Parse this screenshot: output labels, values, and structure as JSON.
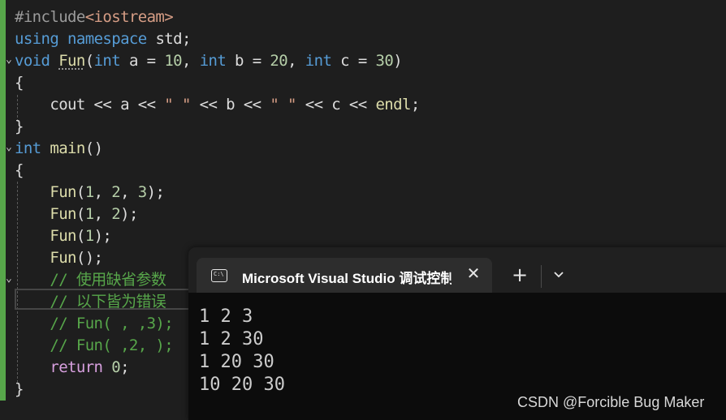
{
  "editor": {
    "lines": [
      {
        "segments": [
          {
            "t": "#include",
            "c": "pp"
          },
          {
            "t": "<iostream>",
            "c": "str"
          }
        ]
      },
      {
        "segments": [
          {
            "t": "using",
            "c": "kw"
          },
          {
            "t": " ",
            "c": "plain"
          },
          {
            "t": "namespace",
            "c": "kw"
          },
          {
            "t": " std;",
            "c": "plain"
          }
        ]
      },
      {
        "segments": [
          {
            "t": "void",
            "c": "kw"
          },
          {
            "t": " ",
            "c": "plain"
          },
          {
            "t": "Fun",
            "c": "fn squig"
          },
          {
            "t": "(",
            "c": "plain"
          },
          {
            "t": "int",
            "c": "kw"
          },
          {
            "t": " a = ",
            "c": "plain"
          },
          {
            "t": "10",
            "c": "num"
          },
          {
            "t": ", ",
            "c": "plain"
          },
          {
            "t": "int",
            "c": "kw"
          },
          {
            "t": " b = ",
            "c": "plain"
          },
          {
            "t": "20",
            "c": "num"
          },
          {
            "t": ", ",
            "c": "plain"
          },
          {
            "t": "int",
            "c": "kw"
          },
          {
            "t": " c = ",
            "c": "plain"
          },
          {
            "t": "30",
            "c": "num"
          },
          {
            "t": ")",
            "c": "plain"
          }
        ]
      },
      {
        "segments": [
          {
            "t": "{",
            "c": "plain"
          }
        ]
      },
      {
        "segments": [
          {
            "t": "    cout << a << ",
            "c": "plain"
          },
          {
            "t": "\" \"",
            "c": "str"
          },
          {
            "t": " << b << ",
            "c": "plain"
          },
          {
            "t": "\" \"",
            "c": "str"
          },
          {
            "t": " << c << ",
            "c": "plain"
          },
          {
            "t": "endl",
            "c": "fn"
          },
          {
            "t": ";",
            "c": "plain"
          }
        ]
      },
      {
        "segments": [
          {
            "t": "}",
            "c": "plain"
          }
        ]
      },
      {
        "segments": [
          {
            "t": "int",
            "c": "kw"
          },
          {
            "t": " ",
            "c": "plain"
          },
          {
            "t": "main",
            "c": "fn"
          },
          {
            "t": "()",
            "c": "plain"
          }
        ]
      },
      {
        "segments": [
          {
            "t": "{",
            "c": "plain"
          }
        ]
      },
      {
        "segments": [
          {
            "t": "    ",
            "c": "plain"
          },
          {
            "t": "Fun",
            "c": "fn"
          },
          {
            "t": "(",
            "c": "plain"
          },
          {
            "t": "1",
            "c": "num"
          },
          {
            "t": ", ",
            "c": "plain"
          },
          {
            "t": "2",
            "c": "num"
          },
          {
            "t": ", ",
            "c": "plain"
          },
          {
            "t": "3",
            "c": "num"
          },
          {
            "t": ");",
            "c": "plain"
          }
        ]
      },
      {
        "segments": [
          {
            "t": "    ",
            "c": "plain"
          },
          {
            "t": "Fun",
            "c": "fn"
          },
          {
            "t": "(",
            "c": "plain"
          },
          {
            "t": "1",
            "c": "num"
          },
          {
            "t": ", ",
            "c": "plain"
          },
          {
            "t": "2",
            "c": "num"
          },
          {
            "t": ");",
            "c": "plain"
          }
        ]
      },
      {
        "segments": [
          {
            "t": "    ",
            "c": "plain"
          },
          {
            "t": "Fun",
            "c": "fn"
          },
          {
            "t": "(",
            "c": "plain"
          },
          {
            "t": "1",
            "c": "num"
          },
          {
            "t": ");",
            "c": "plain"
          }
        ]
      },
      {
        "segments": [
          {
            "t": "    ",
            "c": "plain"
          },
          {
            "t": "Fun",
            "c": "fn"
          },
          {
            "t": "();",
            "c": "plain"
          }
        ]
      },
      {
        "segments": [
          {
            "t": "    // 使用缺省参数",
            "c": "cm"
          }
        ]
      },
      {
        "segments": [
          {
            "t": "    // 以下皆为错误",
            "c": "cm"
          }
        ]
      },
      {
        "segments": [
          {
            "t": "    // Fun( , ,3);",
            "c": "cm"
          }
        ]
      },
      {
        "segments": [
          {
            "t": "    // Fun( ,2, );",
            "c": "cm"
          }
        ]
      },
      {
        "segments": [
          {
            "t": "    ",
            "c": "plain"
          },
          {
            "t": "return",
            "c": "ctl"
          },
          {
            "t": " ",
            "c": "plain"
          },
          {
            "t": "0",
            "c": "num"
          },
          {
            "t": ";",
            "c": "plain"
          }
        ]
      },
      {
        "segments": [
          {
            "t": "}",
            "c": "plain"
          }
        ]
      }
    ],
    "folds": [
      {
        "line": 2,
        "glyph": "⌄"
      },
      {
        "line": 6,
        "glyph": "⌄"
      },
      {
        "line": 12,
        "glyph": "⌄"
      }
    ]
  },
  "terminal": {
    "tab_title": "Microsoft Visual Studio 调试控制台",
    "icon_text": "C:\\",
    "close_glyph": "✕",
    "new_tab_glyph": "+",
    "output": [
      "1 2 3",
      "1 2 30",
      "1 20 30",
      "10 20 30"
    ]
  },
  "watermark": "CSDN @Forcible Bug Maker"
}
